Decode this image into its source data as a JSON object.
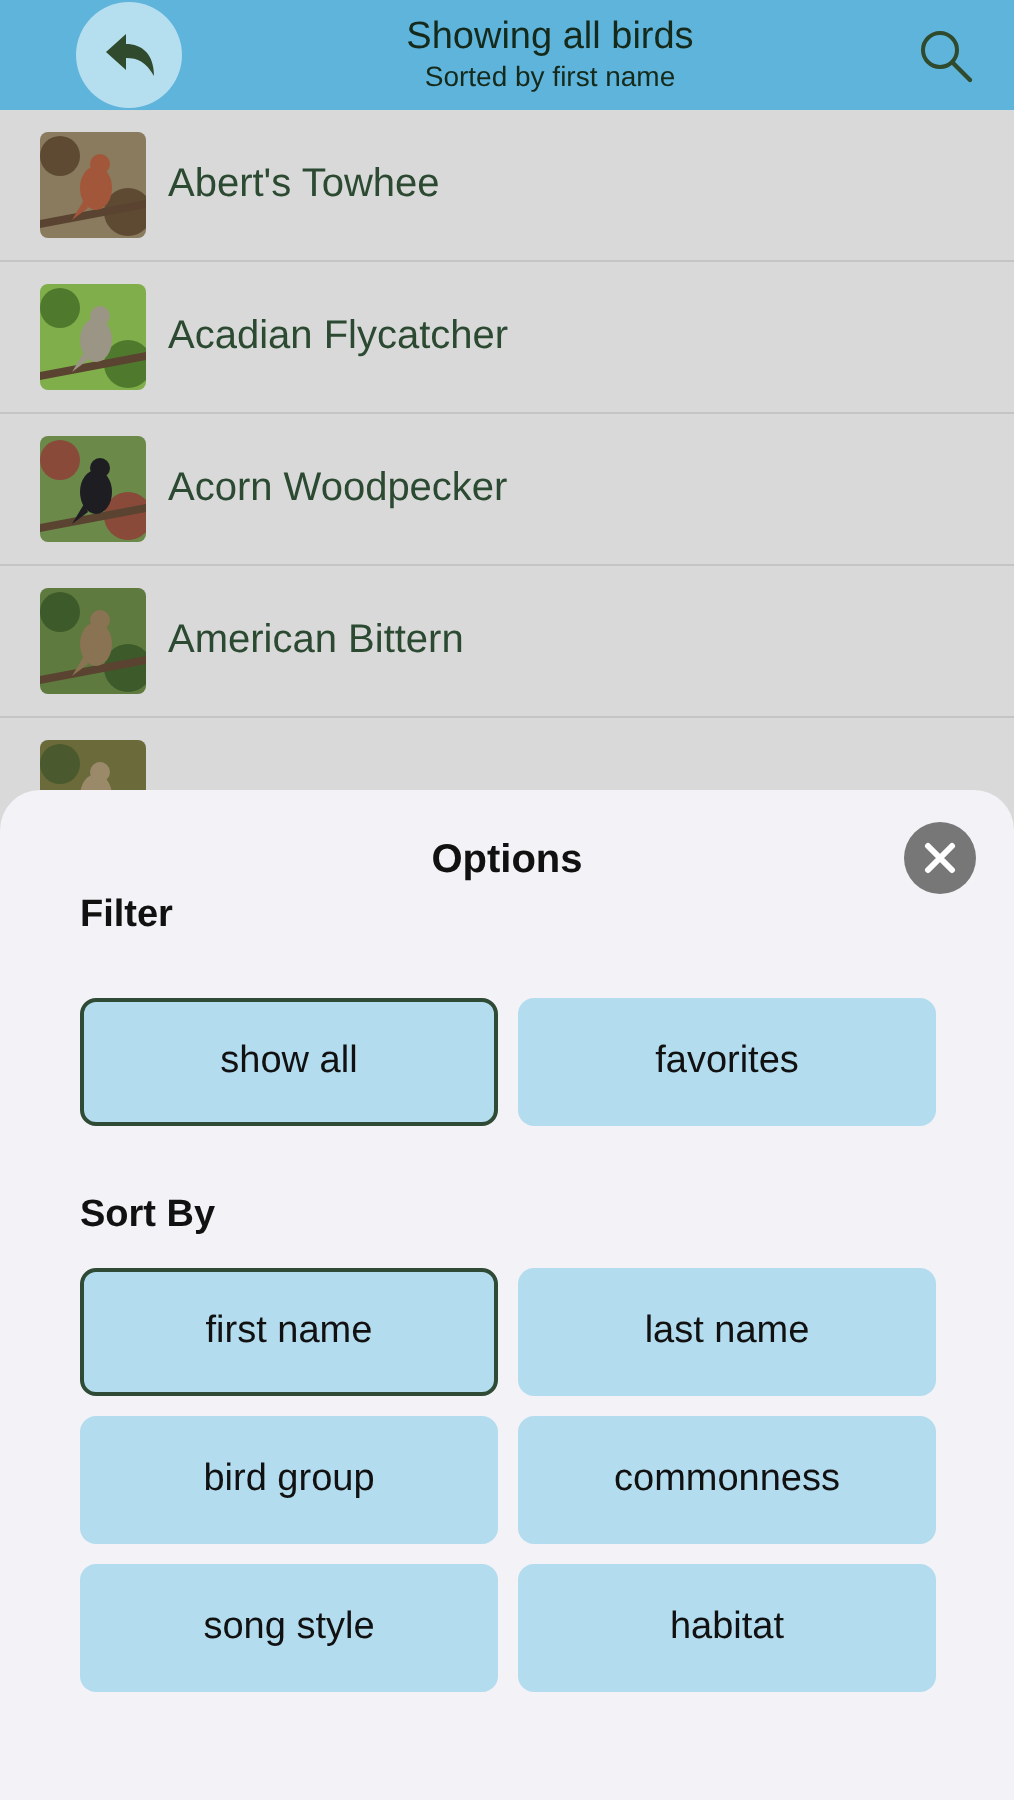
{
  "header": {
    "title": "Showing all birds",
    "subtitle": "Sorted by first name"
  },
  "birds": [
    {
      "name": "Abert's Towhee"
    },
    {
      "name": "Acadian Flycatcher"
    },
    {
      "name": "Acorn Woodpecker"
    },
    {
      "name": "American Bittern"
    }
  ],
  "options": {
    "title": "Options",
    "sections": [
      {
        "heading": "Filter",
        "buttons": [
          {
            "label": "show all",
            "selected": true
          },
          {
            "label": "favorites",
            "selected": false
          }
        ]
      },
      {
        "heading": "Sort By",
        "buttons": [
          {
            "label": "first name",
            "selected": true
          },
          {
            "label": "last name",
            "selected": false
          },
          {
            "label": "bird group",
            "selected": false
          },
          {
            "label": "commonness",
            "selected": false
          },
          {
            "label": "song style",
            "selected": false
          },
          {
            "label": "habitat",
            "selected": false
          }
        ]
      }
    ]
  }
}
